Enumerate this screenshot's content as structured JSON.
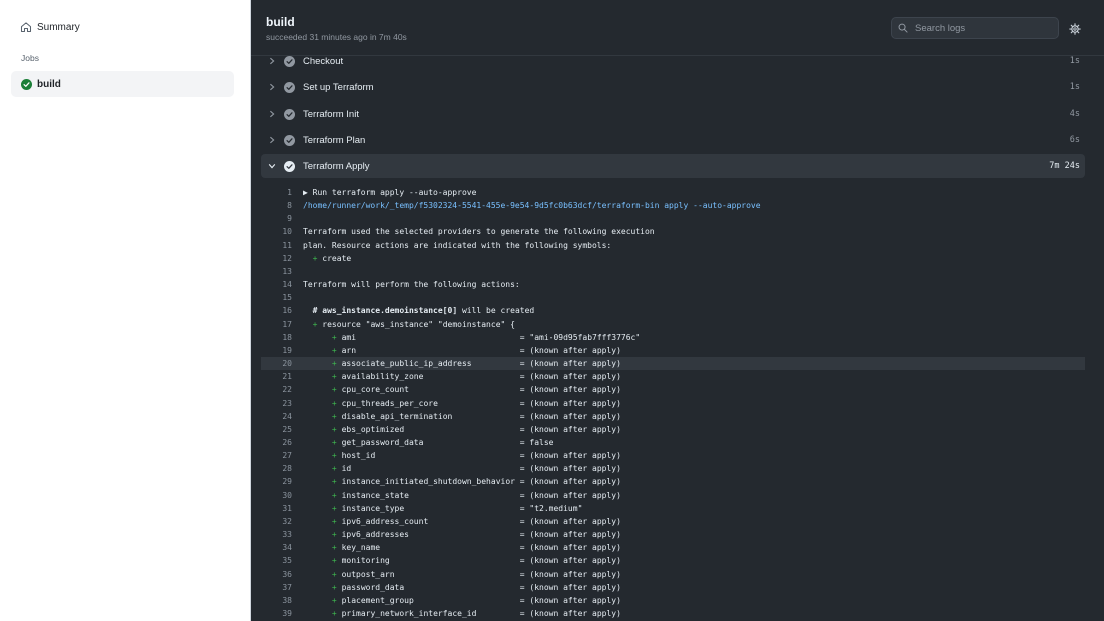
{
  "sidebar": {
    "summary_label": "Summary",
    "jobs_heading": "Jobs",
    "job_label": "build"
  },
  "header": {
    "title": "build",
    "subtitle": "succeeded 31 minutes ago in 7m 40s",
    "search_placeholder": "Search logs"
  },
  "steps": [
    {
      "name": "Checkout",
      "duration": "1s"
    },
    {
      "name": "Set up Terraform",
      "duration": "1s"
    },
    {
      "name": "Terraform Init",
      "duration": "4s"
    },
    {
      "name": "Terraform Plan",
      "duration": "6s"
    },
    {
      "name": "Terraform Apply",
      "duration": "7m 24s"
    }
  ],
  "log": [
    {
      "n": "1",
      "text": "▶ Run terraform apply --auto-approve"
    },
    {
      "n": "8",
      "text": "/home/runner/work/_temp/f5302324-5541-455e-9e54-9d5fc0b63dcf/terraform-bin apply --auto-approve"
    },
    {
      "n": "9",
      "text": ""
    },
    {
      "n": "10",
      "text": "Terraform used the selected providers to generate the following execution"
    },
    {
      "n": "11",
      "text": "plan. Resource actions are indicated with the following symbols:"
    },
    {
      "n": "12",
      "text": "create"
    },
    {
      "n": "13",
      "text": ""
    },
    {
      "n": "14",
      "text": "Terraform will perform the following actions:"
    },
    {
      "n": "15",
      "text": ""
    },
    {
      "n": "16",
      "text": "will be created"
    },
    {
      "n": "17",
      "text": "resource \"aws_instance\" \"demoinstance\" {"
    },
    {
      "n": "18",
      "text": "ami                                  = \"ami-09d95fab7fff3776c\""
    },
    {
      "n": "19",
      "text": "arn                                  = (known after apply)"
    },
    {
      "n": "20",
      "text": "associate_public_ip_address          = (known after apply)"
    },
    {
      "n": "21",
      "text": "availability_zone                    = (known after apply)"
    },
    {
      "n": "22",
      "text": "cpu_core_count                       = (known after apply)"
    },
    {
      "n": "23",
      "text": "cpu_threads_per_core                 = (known after apply)"
    },
    {
      "n": "24",
      "text": "disable_api_termination              = (known after apply)"
    },
    {
      "n": "25",
      "text": "ebs_optimized                        = (known after apply)"
    },
    {
      "n": "26",
      "text": "get_password_data                    = false"
    },
    {
      "n": "27",
      "text": "host_id                              = (known after apply)"
    },
    {
      "n": "28",
      "text": "id                                   = (known after apply)"
    },
    {
      "n": "29",
      "text": "instance_initiated_shutdown_behavior = (known after apply)"
    },
    {
      "n": "30",
      "text": "instance_state                       = (known after apply)"
    },
    {
      "n": "31",
      "text": "instance_type                        = \"t2.medium\""
    },
    {
      "n": "32",
      "text": "ipv6_address_count                   = (known after apply)"
    },
    {
      "n": "33",
      "text": "ipv6_addresses                       = (known after apply)"
    },
    {
      "n": "34",
      "text": "key_name                             = (known after apply)"
    },
    {
      "n": "35",
      "text": "monitoring                           = (known after apply)"
    },
    {
      "n": "36",
      "text": "outpost_arn                          = (known after apply)"
    },
    {
      "n": "37",
      "text": "password_data                        = (known after apply)"
    },
    {
      "n": "38",
      "text": "placement_group                      = (known after apply)"
    },
    {
      "n": "39",
      "text": "primary_network_interface_id         = (known after apply)"
    }
  ],
  "log_resource_address": "# aws_instance.demoinstance[0]",
  "log_plus_symbol": "+",
  "colors": {
    "panel_bg": "#24292f",
    "success": "#3fb950",
    "link": "#79c0ff"
  },
  "icons": {
    "summary": "home-icon",
    "job_status": "check-circle-icon",
    "search": "search-icon",
    "settings": "gear-icon"
  }
}
